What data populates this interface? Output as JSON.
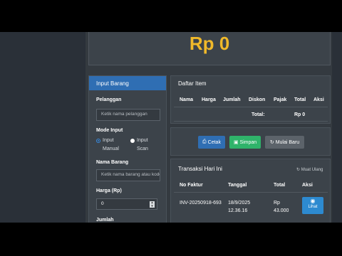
{
  "total": {
    "amount": "Rp 0"
  },
  "input_panel": {
    "title": "Input Barang",
    "customer_label": "Pelanggan",
    "customer_placeholder": "Ketik nama pelanggan",
    "mode_label": "Mode Input",
    "mode_manual_line1": "Input",
    "mode_manual_line2": "Manual",
    "mode_scan_line1": "Input",
    "mode_scan_line2": "Scan",
    "item_name_label": "Nama Barang",
    "item_name_placeholder": "Ketik nama barang atau kode",
    "price_label": "Harga (Rp)",
    "price_value": "0",
    "qty_label": "Jumlah"
  },
  "item_list": {
    "title": "Daftar Item",
    "columns": [
      "Nama",
      "Harga",
      "Jumlah",
      "Diskon",
      "Pajak",
      "Total",
      "Aksi"
    ],
    "total_label": "Total:",
    "total_value": "Rp 0"
  },
  "actions": {
    "print": "Cetak",
    "save": "Simpan",
    "new": "Mulai Baru",
    "colors": {
      "print": "#2f6eb3",
      "save": "#2fb36a",
      "new": "#5c636a"
    }
  },
  "transactions": {
    "title": "Transaksi Hari Ini",
    "reload": "Muat Ulang",
    "columns": [
      "No Faktur",
      "Tanggal",
      "Total",
      "Aksi"
    ],
    "rows": [
      {
        "invoice": "INV-20250918-693",
        "date": "18/9/2025",
        "time": "12.36.16",
        "total_line1": "Rp",
        "total_line2": "43.000",
        "action": "Lihat"
      }
    ]
  },
  "colors": {
    "accent": "#f0b92a",
    "panel_header": "#2f6eb3",
    "background": "#343a40"
  }
}
